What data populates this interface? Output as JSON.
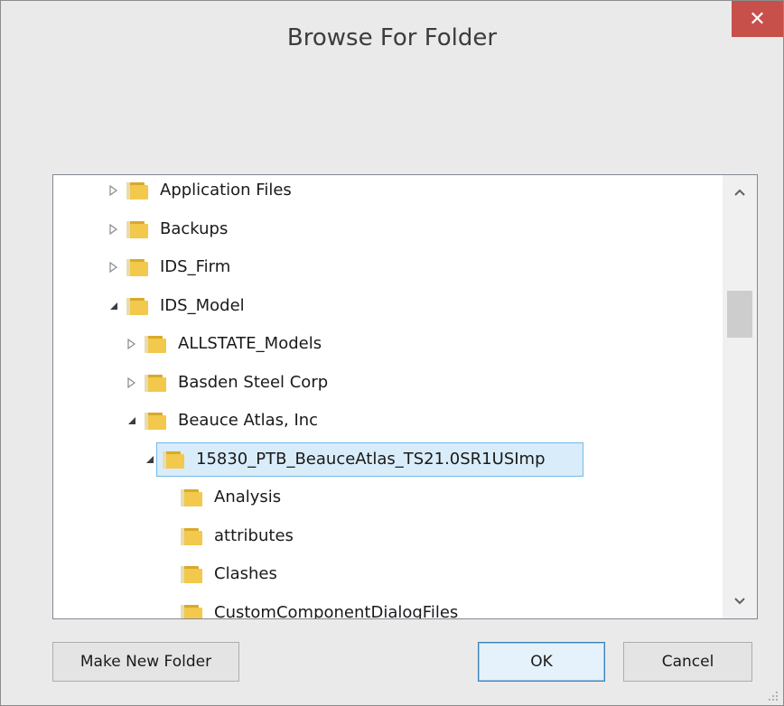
{
  "window": {
    "title": "Browse For Folder",
    "close_glyph": "✕"
  },
  "tree": {
    "items": [
      {
        "label": "Application Files",
        "expander": "collapsed"
      },
      {
        "label": "Backups",
        "expander": "collapsed"
      },
      {
        "label": "IDS_Firm",
        "expander": "collapsed"
      },
      {
        "label": "IDS_Model",
        "expander": "expanded"
      },
      {
        "label": "ALLSTATE_Models",
        "expander": "collapsed"
      },
      {
        "label": "Basden Steel Corp",
        "expander": "collapsed"
      },
      {
        "label": "Beauce Atlas, Inc",
        "expander": "expanded"
      },
      {
        "label": "15830_PTB_BeauceAtlas_TS21.0SR1USImp",
        "expander": "expanded",
        "selected": true
      },
      {
        "label": "Analysis",
        "expander": "none"
      },
      {
        "label": "attributes",
        "expander": "none"
      },
      {
        "label": "Clashes",
        "expander": "none"
      },
      {
        "label": "CustomComponentDialogFiles",
        "expander": "none"
      }
    ]
  },
  "buttons": {
    "make_new_folder": "Make New Folder",
    "ok": "OK",
    "cancel": "Cancel"
  },
  "colors": {
    "close_button": "#c7504b",
    "selection_border": "#73b9e6",
    "selection_fill": "#d9ecfa",
    "folder_fill": "#f2c94c",
    "folder_dark": "#d9a92a"
  },
  "icons": {
    "folder": "folder-icon",
    "expand_collapsed": "triangle-right-outline-icon",
    "expand_expanded": "triangle-down-filled-icon",
    "scroll_up": "chevron-up-icon",
    "scroll_down": "chevron-down-icon"
  }
}
